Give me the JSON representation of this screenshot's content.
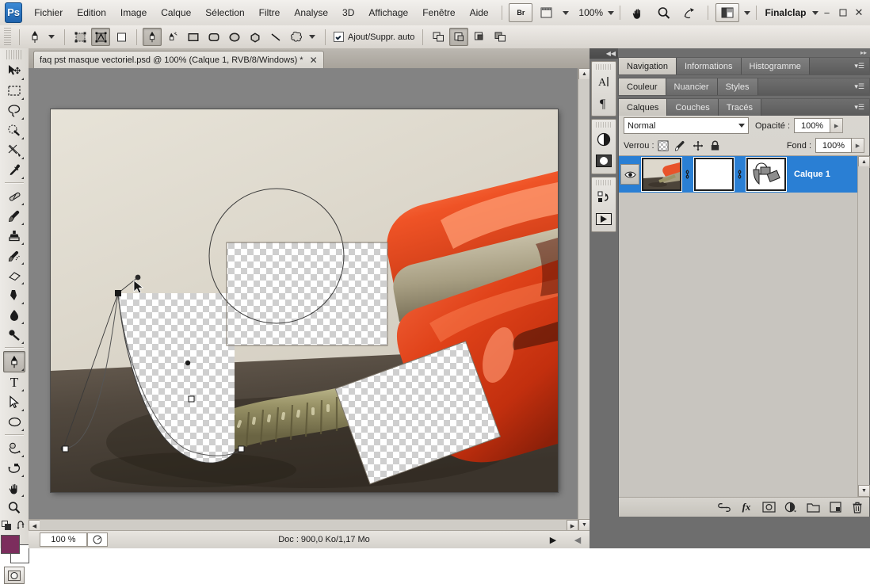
{
  "app": {
    "name": "Adobe Photoshop",
    "logo_text": "Ps",
    "workspace": "Finalclap",
    "zoom_label": "100%"
  },
  "menubar": {
    "items": [
      {
        "label": "Fichier"
      },
      {
        "label": "Edition"
      },
      {
        "label": "Image"
      },
      {
        "label": "Calque"
      },
      {
        "label": "Sélection"
      },
      {
        "label": "Filtre"
      },
      {
        "label": "Analyse"
      },
      {
        "label": "3D"
      },
      {
        "label": "Affichage"
      },
      {
        "label": "Fenêtre"
      },
      {
        "label": "Aide"
      }
    ],
    "bridge_label": "Br",
    "icons": {
      "bridge": "bridge-icon",
      "view_extras": "view-extras-icon",
      "hand": "hand-icon",
      "zoom": "zoom-icon",
      "rotate_view": "rotate-view-icon",
      "arrange": "arrange-documents-icon",
      "workspace_caret": "chevron-down-icon"
    },
    "window_controls": {
      "minimize": "−",
      "maximize": "▭",
      "close": "✕"
    }
  },
  "optionsbar": {
    "tool_icon": "pen-tool-icon",
    "mode_buttons": [
      {
        "name": "shape-layers-mode",
        "active": false
      },
      {
        "name": "paths-mode",
        "active": true
      },
      {
        "name": "fill-pixels-mode",
        "active": false
      }
    ],
    "tool_shortcuts": [
      {
        "name": "pen-tool",
        "active": true
      },
      {
        "name": "freeform-pen-tool",
        "active": false
      },
      {
        "name": "rectangle-tool",
        "active": false
      },
      {
        "name": "rounded-rectangle-tool",
        "active": false
      },
      {
        "name": "ellipse-tool",
        "active": false
      },
      {
        "name": "polygon-tool",
        "active": false
      },
      {
        "name": "line-tool",
        "active": false
      },
      {
        "name": "custom-shape-tool",
        "active": false
      }
    ],
    "auto_addremove": {
      "label": "Ajout/Suppr. auto",
      "checked": true
    },
    "path_ops": [
      {
        "name": "add-to-path-area",
        "active": false
      },
      {
        "name": "subtract-from-path-area",
        "active": true
      },
      {
        "name": "intersect-path-areas",
        "active": false
      },
      {
        "name": "exclude-overlapping-path-areas",
        "active": false
      }
    ]
  },
  "toolbar": {
    "tools": [
      {
        "name": "move-tool",
        "selected": false,
        "hasmenu": true
      },
      {
        "name": "rectangular-marquee-tool",
        "selected": false,
        "hasmenu": true
      },
      {
        "name": "lasso-tool",
        "selected": false,
        "hasmenu": true
      },
      {
        "name": "quick-selection-tool",
        "selected": false,
        "hasmenu": true
      },
      {
        "name": "crop-tool",
        "selected": false,
        "hasmenu": true
      },
      {
        "name": "eyedropper-tool",
        "selected": false,
        "hasmenu": true
      },
      {
        "name": "spot-healing-brush-tool",
        "selected": false,
        "hasmenu": true
      },
      {
        "name": "brush-tool",
        "selected": false,
        "hasmenu": true
      },
      {
        "name": "clone-stamp-tool",
        "selected": false,
        "hasmenu": true
      },
      {
        "name": "history-brush-tool",
        "selected": false,
        "hasmenu": true
      },
      {
        "name": "eraser-tool",
        "selected": false,
        "hasmenu": true
      },
      {
        "name": "gradient-tool",
        "selected": false,
        "hasmenu": true
      },
      {
        "name": "blur-tool",
        "selected": false,
        "hasmenu": true
      },
      {
        "name": "dodge-tool",
        "selected": false,
        "hasmenu": true
      },
      {
        "name": "pen-tool",
        "selected": true,
        "hasmenu": true
      },
      {
        "name": "horizontal-type-tool",
        "selected": false,
        "hasmenu": true
      },
      {
        "name": "path-selection-tool",
        "selected": false,
        "hasmenu": true
      },
      {
        "name": "ellipse-shape-tool",
        "selected": false,
        "hasmenu": true
      },
      {
        "name": "3d-rotate-tool",
        "selected": false,
        "hasmenu": true
      },
      {
        "name": "3d-orbit-tool",
        "selected": false,
        "hasmenu": true
      },
      {
        "name": "hand-tool",
        "selected": false,
        "hasmenu": true
      },
      {
        "name": "zoom-tool",
        "selected": false,
        "hasmenu": false
      }
    ],
    "colors": {
      "foreground": "#7c2d5d",
      "background": "#ffffff",
      "default_colors_icon": "default-colors-icon",
      "swap_colors_icon": "swap-colors-icon"
    },
    "quickmask_icon": "quick-mask-icon"
  },
  "document": {
    "tab_title": "faq pst masque vectoriel.psd @ 100% (Calque 1, RVB/8/Windows) *",
    "close_glyph": "✕"
  },
  "statusbar": {
    "zoom": "100 %",
    "doc_info": "Doc : 900,0 Ko/1,17 Mo",
    "arrow_glyph": "▶",
    "left_arrow_glyph": "◀"
  },
  "icondock": {
    "collapse_glyph": "◀◀",
    "groups": [
      {
        "buttons": [
          {
            "name": "character-panel-icon",
            "glyph": "A"
          },
          {
            "name": "paragraph-panel-icon",
            "glyph": "¶"
          }
        ]
      },
      {
        "buttons": [
          {
            "name": "adjustments-panel-icon",
            "glyph": "◐"
          },
          {
            "name": "masks-panel-icon",
            "glyph": "◉"
          }
        ]
      },
      {
        "buttons": [
          {
            "name": "history-panel-icon",
            "glyph": "↰"
          },
          {
            "name": "actions-panel-icon",
            "glyph": "▶"
          }
        ]
      }
    ]
  },
  "panels": {
    "collapse_glyph": "▸▸",
    "menu_glyph": "▾☰",
    "group_navigation": {
      "tabs": [
        {
          "label": "Navigation",
          "active": true
        },
        {
          "label": "Informations",
          "active": false
        },
        {
          "label": "Histogramme",
          "active": false
        }
      ]
    },
    "group_color": {
      "tabs": [
        {
          "label": "Couleur",
          "active": true
        },
        {
          "label": "Nuancier",
          "active": false
        },
        {
          "label": "Styles",
          "active": false
        }
      ]
    },
    "group_layers": {
      "tabs": [
        {
          "label": "Calques",
          "active": true
        },
        {
          "label": "Couches",
          "active": false
        },
        {
          "label": "Tracés",
          "active": false
        }
      ],
      "blend_mode": "Normal",
      "opacity_label": "Opacité :",
      "opacity_value": "100%",
      "lock_label": "Verrou :",
      "lock_icons": [
        {
          "name": "lock-transparent-pixels-icon"
        },
        {
          "name": "lock-image-pixels-icon"
        },
        {
          "name": "lock-position-icon"
        },
        {
          "name": "lock-all-icon"
        }
      ],
      "fill_label": "Fond :",
      "fill_value": "100%",
      "layers": [
        {
          "name": "Calque 1",
          "visible": true,
          "selected": true,
          "has_layer_thumb": true,
          "has_layer_mask": true,
          "has_vector_mask": true,
          "link1_glyph": "⫯",
          "link2_glyph": "⫯"
        }
      ],
      "footer_buttons": [
        {
          "name": "link-layers-button",
          "glyph": "⚯"
        },
        {
          "name": "layer-style-button",
          "glyph": "fx"
        },
        {
          "name": "add-layer-mask-button",
          "glyph": "◻"
        },
        {
          "name": "new-fill-adjustment-layer-button",
          "glyph": "◑"
        },
        {
          "name": "new-group-button",
          "glyph": "▭"
        },
        {
          "name": "new-layer-button",
          "glyph": "▣"
        },
        {
          "name": "delete-layer-button",
          "glyph": "🗑"
        }
      ]
    }
  },
  "canvas": {
    "description": "Red rotary telephone photo with vector mask cutouts showing transparency checkerboard",
    "accent_red": "#e04a1e",
    "background_wall": "#ded9ce",
    "cord_color": "#9a9468",
    "pen_path_visible": true,
    "cursor_glyph": "pen-cursor"
  }
}
